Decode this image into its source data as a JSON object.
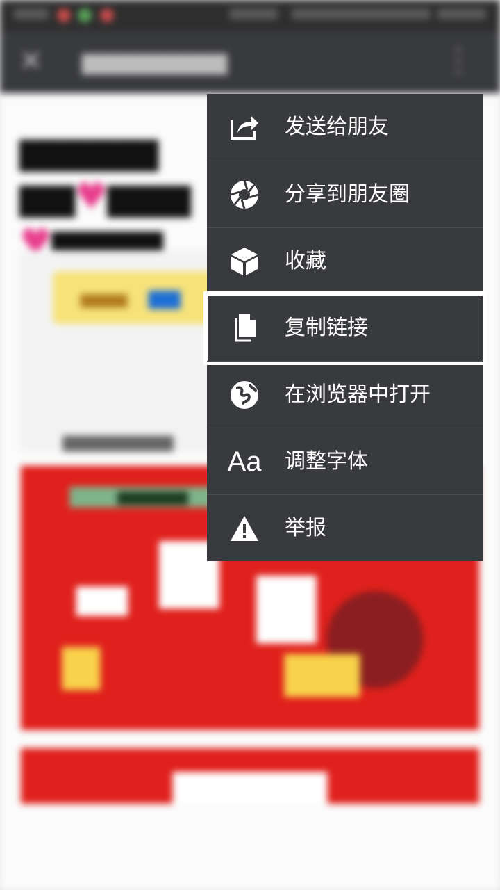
{
  "menu": {
    "items": [
      {
        "label": "发送给朋友",
        "icon": "share-forward-icon"
      },
      {
        "label": "分享到朋友圈",
        "icon": "moments-aperture-icon"
      },
      {
        "label": "收藏",
        "icon": "favorite-box-icon"
      },
      {
        "label": "复制链接",
        "icon": "copy-document-icon"
      },
      {
        "label": "在浏览器中打开",
        "icon": "globe-icon"
      },
      {
        "label": "调整字体",
        "icon": "font-size-icon",
        "glyph": "Aa"
      },
      {
        "label": "举报",
        "icon": "warning-icon"
      }
    ],
    "selected_index": 3
  },
  "colors": {
    "menu_bg": "#393a3e",
    "menu_text": "#ffffff",
    "selection_outline": "#ffffff",
    "navbar_bg": "#393a3e",
    "poster_red": "#e0201c"
  }
}
